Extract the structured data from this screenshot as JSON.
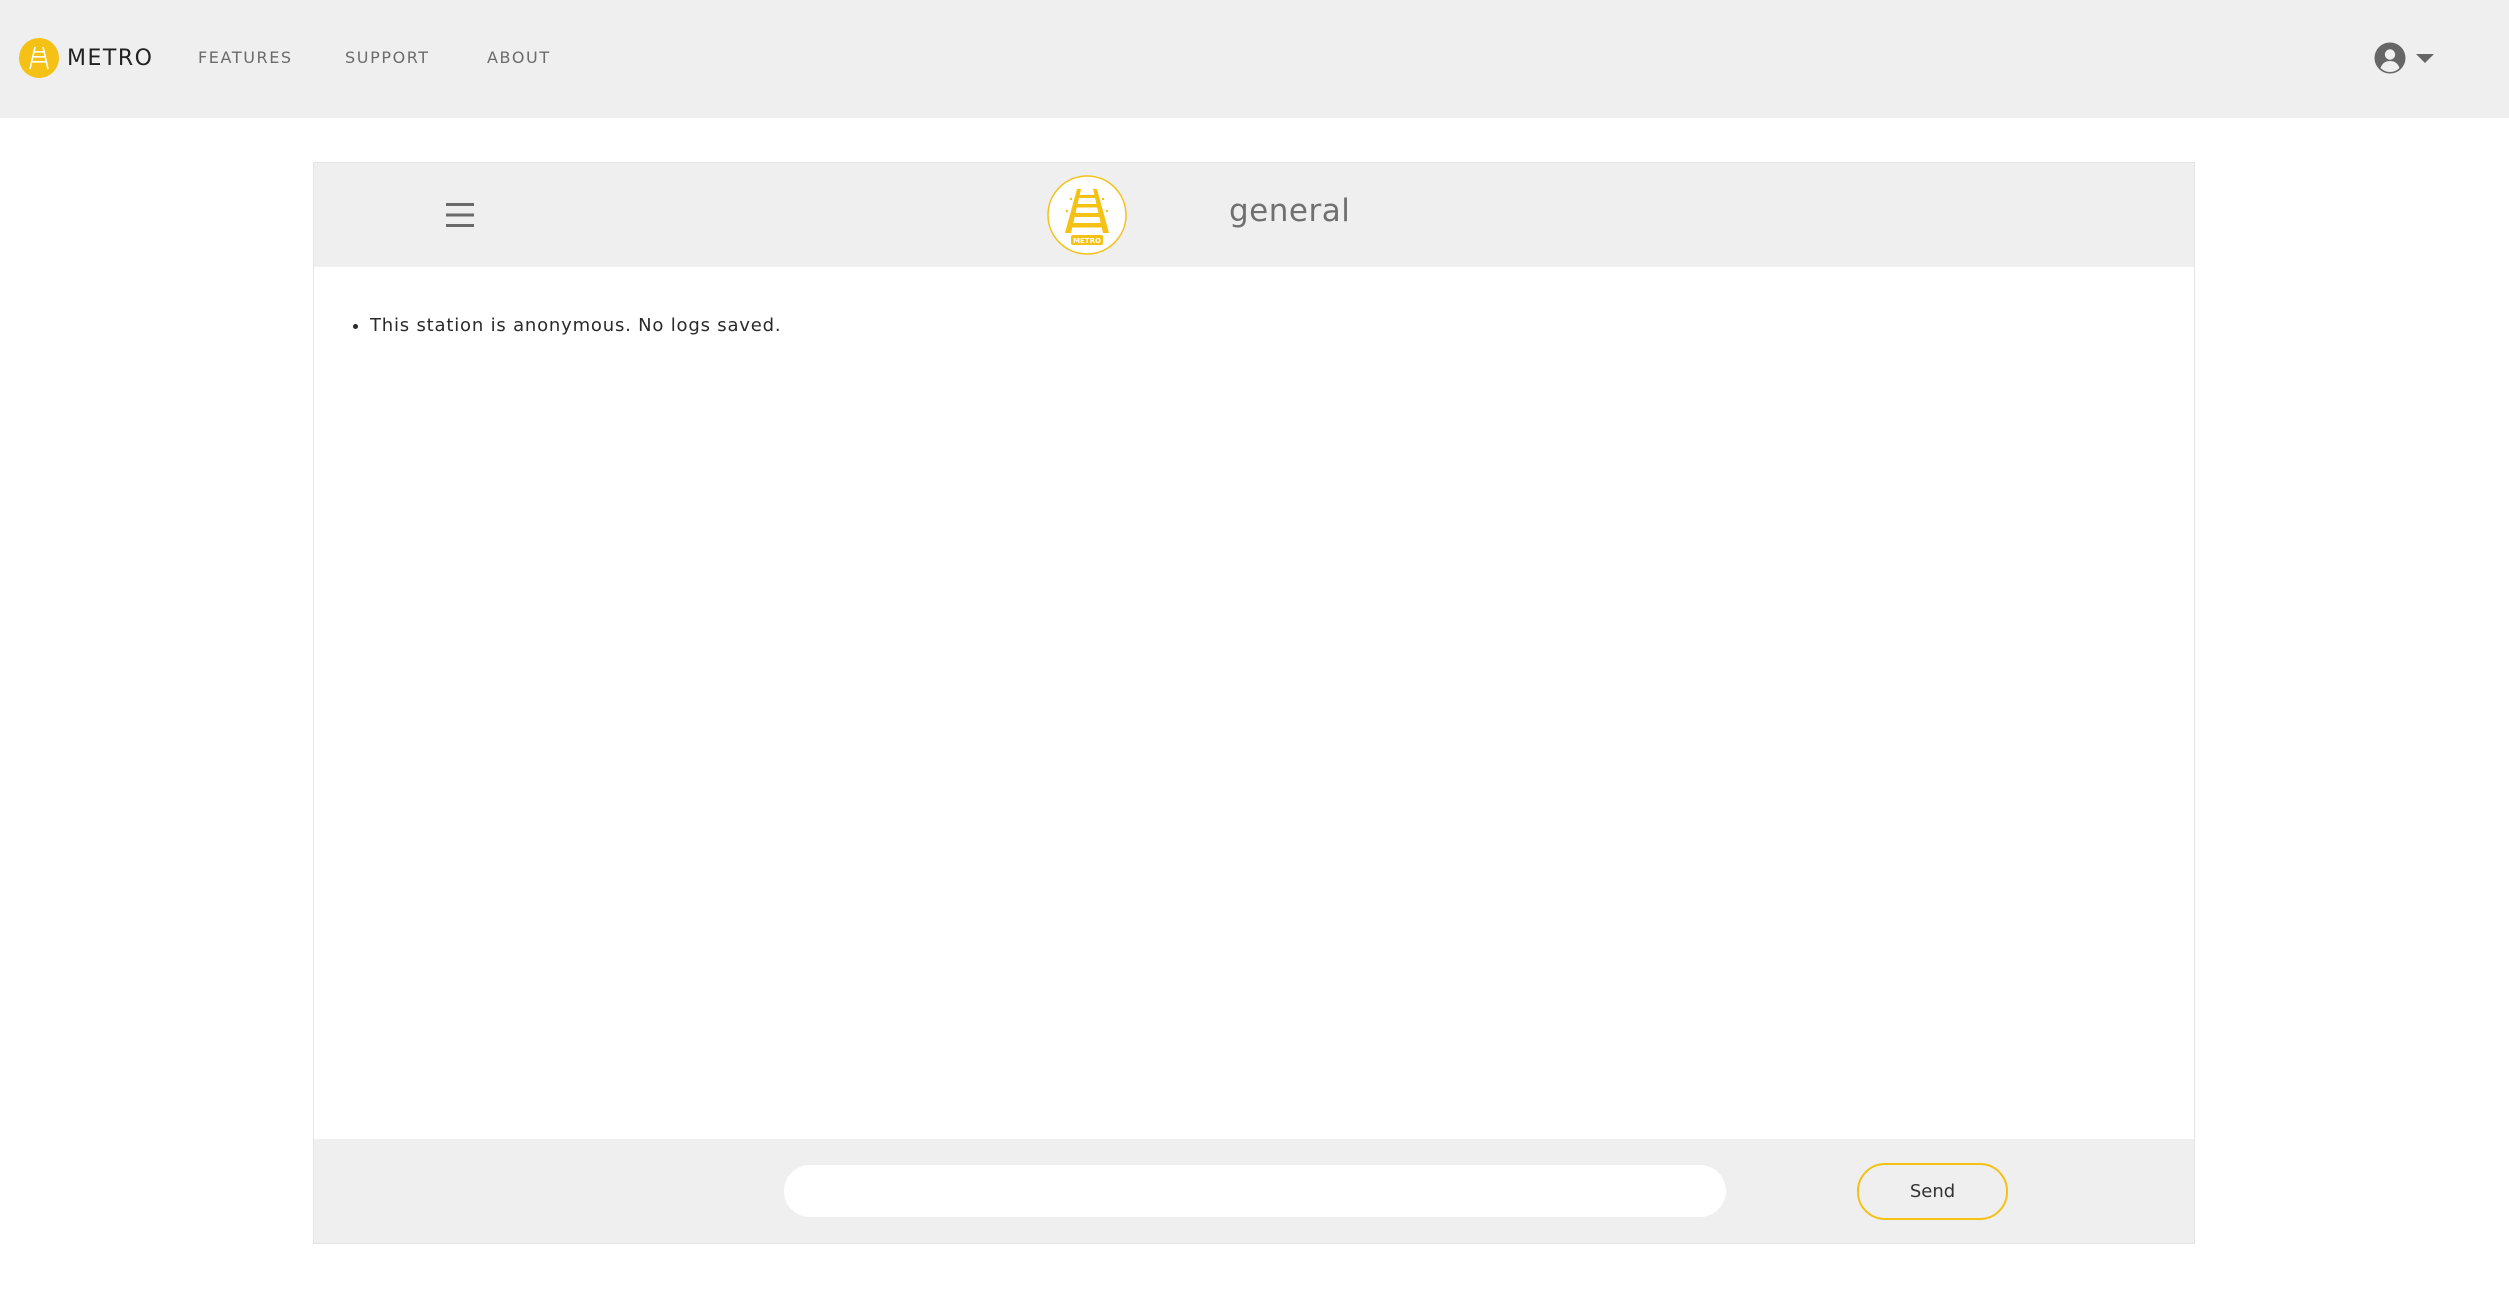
{
  "colors": {
    "accent": "#f4c114",
    "topbar_bg": "#efefef",
    "panel_bg": "#ffffff"
  },
  "topbar": {
    "brand_name": "METRO",
    "brand_icon": "metro-logo-icon",
    "nav": [
      {
        "label": "FEATURES"
      },
      {
        "label": "SUPPORT"
      },
      {
        "label": "ABOUT"
      }
    ],
    "account_icon": "user-circle-icon",
    "account_menu_icon": "caret-down-icon"
  },
  "chat": {
    "menu_icon": "hamburger-menu-icon",
    "channel_logo_text": "METRO",
    "channel_name": "general",
    "messages": [
      {
        "text": "This station is anonymous. No logs saved."
      }
    ],
    "composer": {
      "input_value": "",
      "input_placeholder": "",
      "send_label": "Send"
    }
  }
}
